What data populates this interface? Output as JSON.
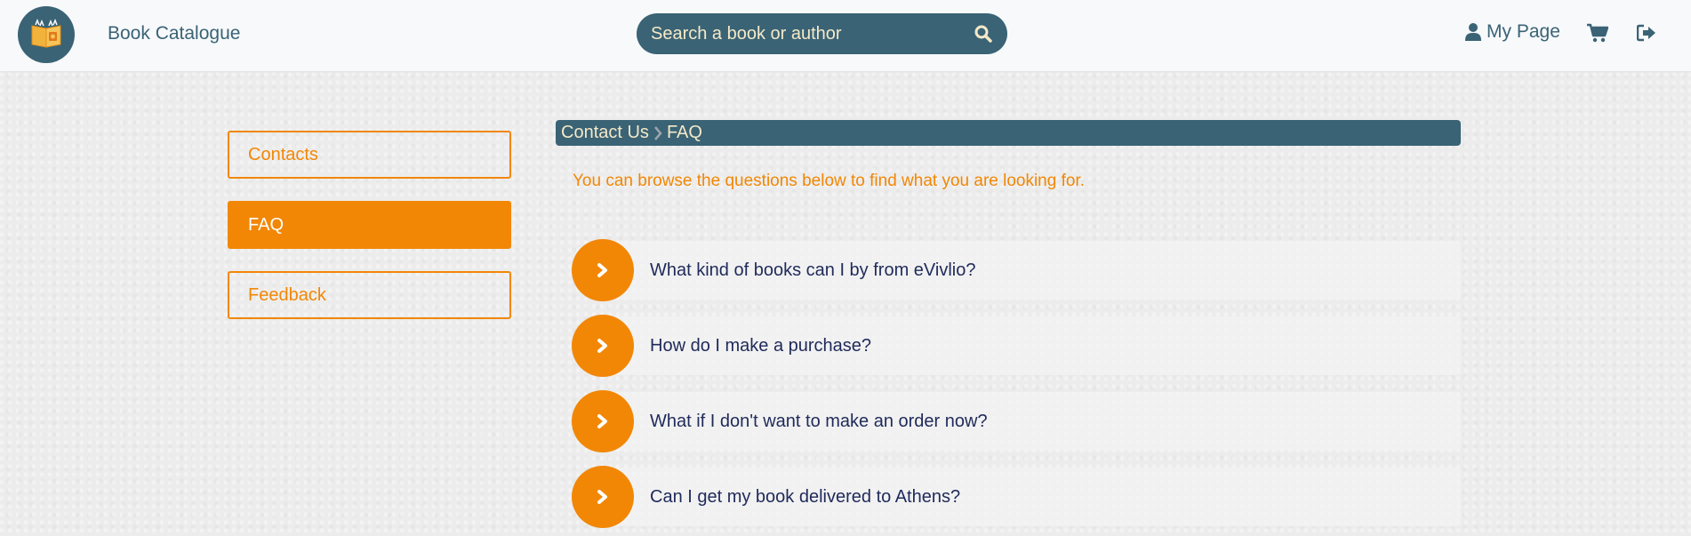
{
  "header": {
    "brand": "Book Catalogue",
    "search_placeholder": "Search a book or author",
    "my_page": "My Page"
  },
  "sidebar": {
    "items": [
      {
        "label": "Contacts",
        "active": false
      },
      {
        "label": "FAQ",
        "active": true
      },
      {
        "label": "Feedback",
        "active": false
      }
    ]
  },
  "breadcrumb": {
    "parent": "Contact Us",
    "current": "FAQ"
  },
  "intro": "You can browse the questions below to find what you are looking for.",
  "faq": [
    "What kind of books can I by from eVivlio?",
    "How do I make a purchase?",
    "What if I don't want to make an order now?",
    "Can I get my book delivered to Athens?"
  ],
  "colors": {
    "primary": "#3a6375",
    "accent": "#f28705",
    "cream": "#f5e9c8",
    "question_text": "#1f2a5a"
  }
}
